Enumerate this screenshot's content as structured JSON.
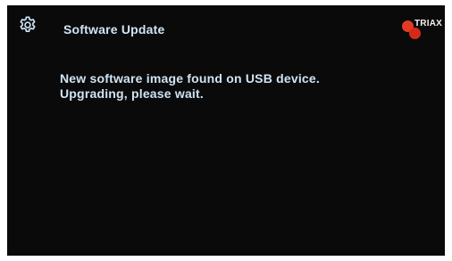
{
  "header": {
    "title": "Software Update",
    "settings_icon": "gear-icon"
  },
  "logo": {
    "brand": "TRIAX",
    "colors": {
      "dot": "#e23b22",
      "text": "#f1f1f1"
    }
  },
  "message": {
    "line1": "New software image found on USB device.",
    "line2": "Upgrading, please wait."
  },
  "colors": {
    "background": "#0a0a0a",
    "text": "#cfe4f4"
  }
}
